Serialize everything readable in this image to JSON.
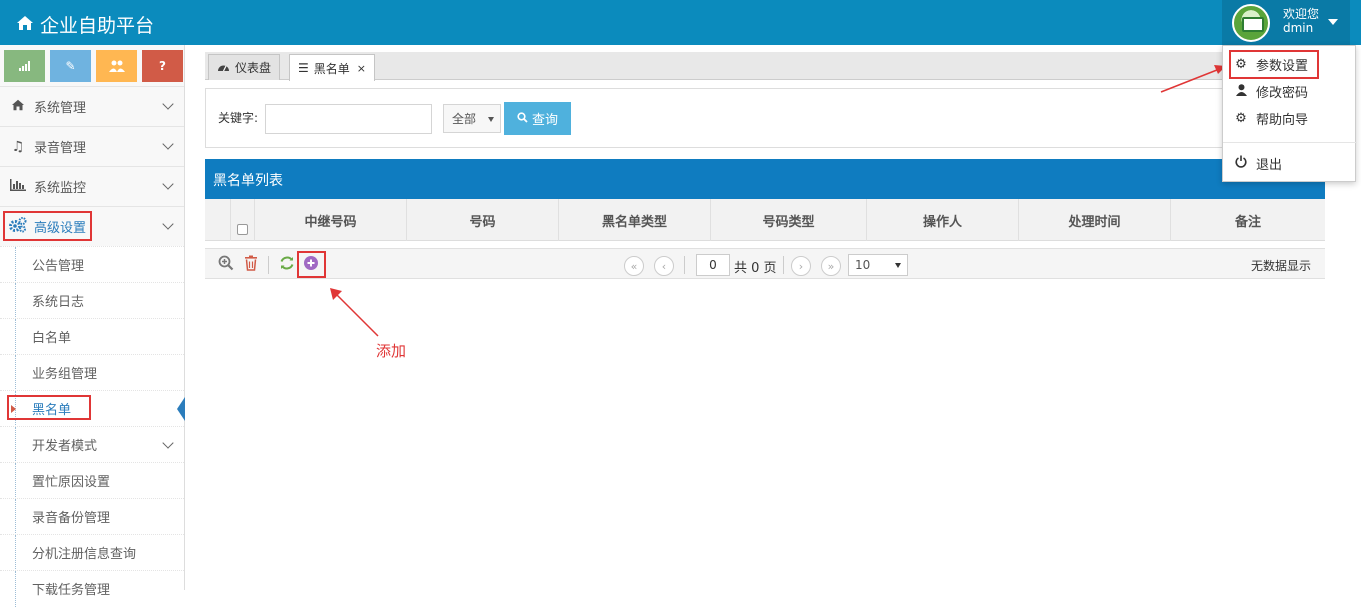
{
  "header": {
    "title": "企业自助平台",
    "user": {
      "greeting": "欢迎您",
      "name": "dmin"
    }
  },
  "user_menu": {
    "items": [
      {
        "label": "参数设置",
        "icon": "gear-icon"
      },
      {
        "label": "修改密码",
        "icon": "user-icon"
      },
      {
        "label": "帮助向导",
        "icon": "gear-icon"
      },
      {
        "label": "退出",
        "icon": "power-icon"
      }
    ]
  },
  "sidebar": {
    "shortcuts": [
      {
        "icon": "signal-icon",
        "color": "#87b87f"
      },
      {
        "icon": "pencil-icon",
        "color": "#6fb3e0"
      },
      {
        "icon": "users-icon",
        "color": "#ffb752"
      },
      {
        "icon": "question-icon",
        "color": "#d15b47"
      }
    ],
    "menu": [
      {
        "label": "系统管理",
        "icon": "home-icon"
      },
      {
        "label": "录音管理",
        "icon": "music-icon"
      },
      {
        "label": "系统监控",
        "icon": "bar-chart-icon"
      },
      {
        "label": "高级设置",
        "icon": "cogs-icon"
      }
    ],
    "submenu": [
      {
        "label": "公告管理"
      },
      {
        "label": "系统日志"
      },
      {
        "label": "白名单"
      },
      {
        "label": "业务组管理"
      },
      {
        "label": "黑名单"
      },
      {
        "label": "开发者模式"
      },
      {
        "label": "置忙原因设置"
      },
      {
        "label": "录音备份管理"
      },
      {
        "label": "分机注册信息查询"
      },
      {
        "label": "下载任务管理"
      }
    ]
  },
  "tabs": [
    {
      "label": "仪表盘",
      "icon": "dashboard-icon"
    },
    {
      "label": "黑名单",
      "icon": "list-icon",
      "close": "×"
    }
  ],
  "search": {
    "keyword_label": "关键字:",
    "keyword_value": "",
    "scope_selected": "全部",
    "query_label": "查询"
  },
  "grid": {
    "title": "黑名单列表",
    "columns": [
      "中继号码",
      "号码",
      "黑名单类型",
      "号码类型",
      "操作人",
      "处理时间",
      "备注"
    ]
  },
  "pager": {
    "page": "0",
    "total_label": "共 0 页",
    "page_size": "10",
    "empty_text": "无数据显示"
  },
  "annotation": {
    "text": "添加"
  },
  "colors": {
    "header_bg": "#0b8bbd",
    "grid_title_bg": "#0f7cc0",
    "query_button": "#4fb1dd",
    "highlight": "#e03636"
  }
}
